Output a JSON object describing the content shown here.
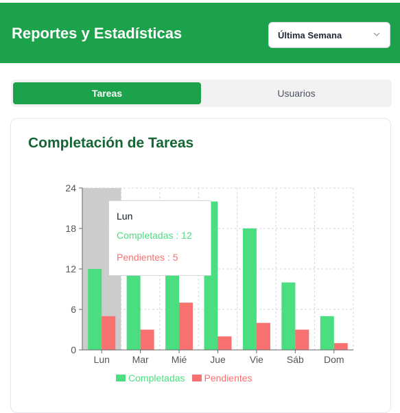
{
  "header": {
    "title": "Reportes y Estadísticas"
  },
  "period_select": {
    "value": "Última Semana"
  },
  "tabs": [
    {
      "label": "Tareas",
      "active": true
    },
    {
      "label": "Usuarios",
      "active": false
    }
  ],
  "colors": {
    "brand": "#1ba24b",
    "completed": "#4ade80",
    "pending": "#f87171",
    "title": "#166534"
  },
  "card": {
    "title": "Completación de Tareas"
  },
  "tooltip": {
    "label": "Lun",
    "completed_text": "Completadas : 12",
    "pending_text": "Pendientes : 5"
  },
  "chart_data": {
    "type": "bar",
    "categories": [
      "Lun",
      "Mar",
      "Mié",
      "Jue",
      "Vie",
      "Sáb",
      "Dom"
    ],
    "series": [
      {
        "name": "Completadas",
        "values": [
          12,
          15,
          14,
          22,
          18,
          10,
          5
        ]
      },
      {
        "name": "Pendientes",
        "values": [
          5,
          3,
          7,
          2,
          4,
          3,
          1
        ]
      }
    ],
    "ylim": [
      0,
      24
    ],
    "yticks": [
      0,
      6,
      12,
      18,
      24
    ],
    "grid": true,
    "legend": "bottom",
    "highlighted_category": "Lun"
  }
}
